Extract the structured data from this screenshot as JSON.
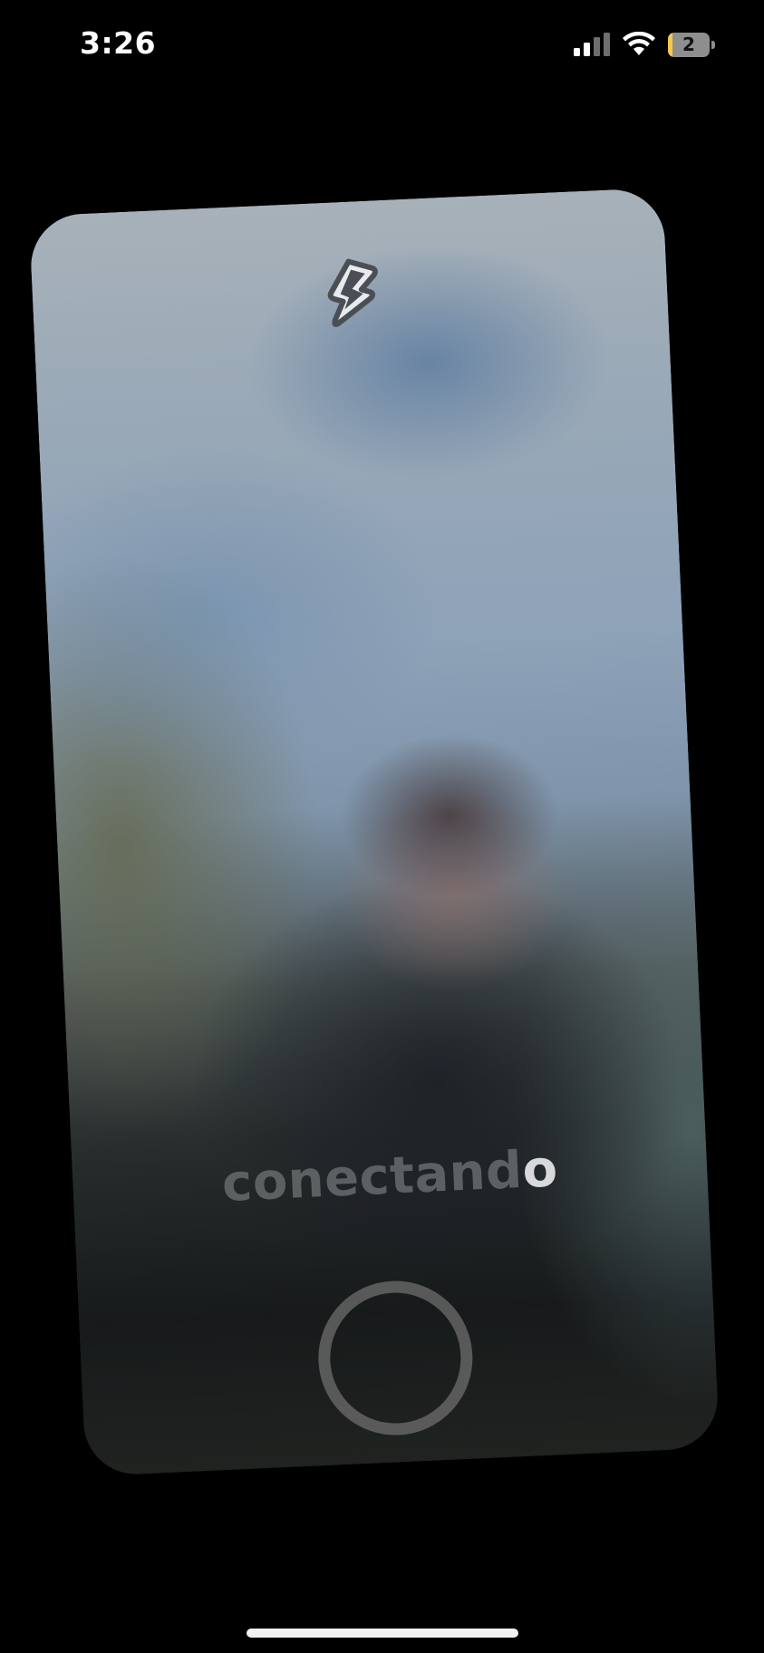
{
  "status_bar": {
    "time": "3:26",
    "signal_icon": "cellular-signal-icon",
    "wifi_icon": "wifi-icon",
    "battery_level": "2",
    "battery_fraction": 0.1
  },
  "camera": {
    "flash_icon": "lightning-bolt-icon",
    "status_text_dim": "conectand",
    "status_text_lit": "o",
    "shutter_icon": "capture-ring-icon"
  },
  "colors": {
    "background": "#000000",
    "text_dim": "#5d6063",
    "text_lit": "#d8d9db",
    "battery_fill": "#f2c94c"
  }
}
